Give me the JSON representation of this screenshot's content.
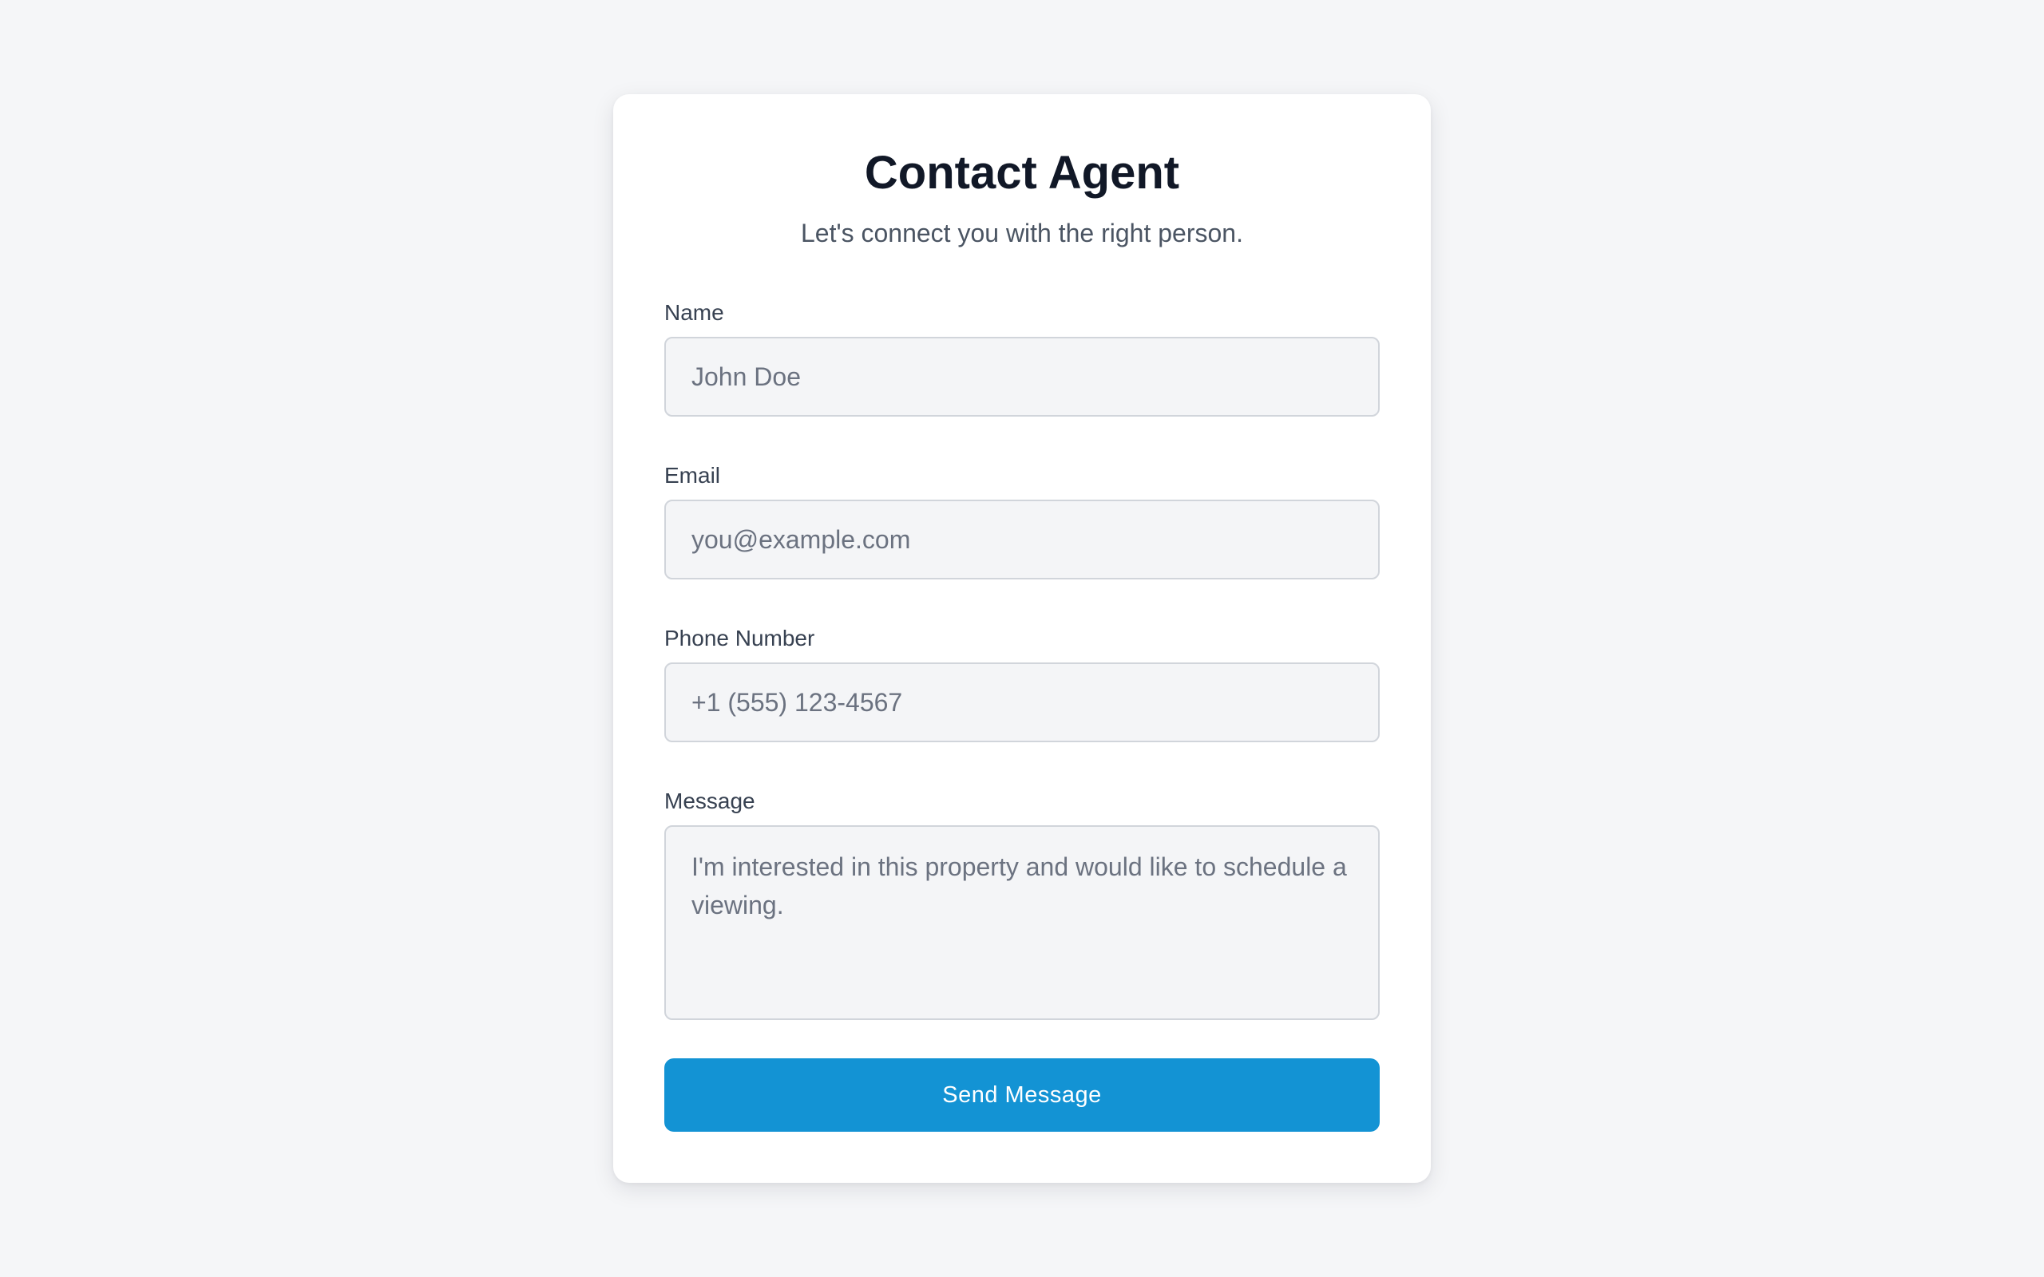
{
  "form": {
    "title": "Contact Agent",
    "subtitle": "Let's connect you with the right person.",
    "fields": {
      "name": {
        "label": "Name",
        "placeholder": "John Doe",
        "value": ""
      },
      "email": {
        "label": "Email",
        "placeholder": "you@example.com",
        "value": ""
      },
      "phone": {
        "label": "Phone Number",
        "placeholder": "+1 (555) 123-4567",
        "value": ""
      },
      "message": {
        "label": "Message",
        "placeholder": "I'm interested in this property and would like to schedule a viewing.",
        "value": ""
      }
    },
    "submit_label": "Send Message"
  },
  "colors": {
    "background": "#f5f6f8",
    "card": "#ffffff",
    "accent": "#1393d4",
    "input_background": "#f4f5f7",
    "input_border": "#d1d5db",
    "title_text": "#111827"
  }
}
